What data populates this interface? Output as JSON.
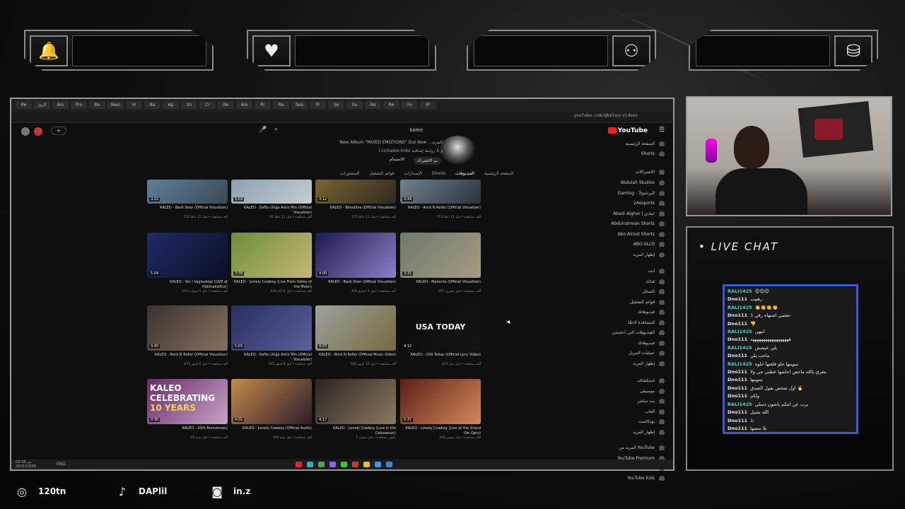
{
  "alerts": [
    {
      "icon": "bell-icon",
      "glyph": "🔔"
    },
    {
      "icon": "heart-hand-icon",
      "glyph": "♥"
    },
    {
      "icon": "users-icon",
      "glyph": "⚇"
    },
    {
      "icon": "coins-icon",
      "glyph": "⛁"
    }
  ],
  "browser": {
    "url": "youtube.com/@kaleo/videos",
    "tabs": [
      "Re",
      "الرئ",
      "Am",
      "Pro",
      "Bo",
      "Nwo",
      "Vi",
      "Ba",
      "Ap",
      "Sn",
      "Cr",
      "Re",
      "Am",
      "Pr",
      "Re",
      "Sea",
      "Pi",
      "Se",
      "Sa",
      "Re",
      "Re",
      "Fo",
      "Pr"
    ]
  },
  "youtube": {
    "logo": "YouTube",
    "search_text": "kaleo",
    "channel_line1": "New Album \"MIXED EMOTIONS\" Out Now ...المزيد",
    "channel_line2": "l.co/kaleo-links و 5 روابط إضافية",
    "subscribe_label": "تم الاشتراك",
    "join_label": "الانضمام",
    "channel_tabs": [
      "الصفحة الرئيسية",
      "الفيديوهات",
      "Shorts",
      "الإصدارات",
      "قوائم التشغيل",
      "المنشورات"
    ],
    "sidebar": [
      "الصفحة الرئيسية",
      "Shorts",
      "الاشتراكات",
      "Sbdulah Studios",
      "Gaming - 3البرنامج",
      "24esports",
      "Abadi Alghar | عبادي",
      "Abdulrahman Shorts",
      "Abo Alroot Shorts",
      "ABO-SLLD",
      "إظهار المزيد",
      "أنت",
      "قناتك",
      "السجل",
      "قوائم التشغيل",
      "فيديوهاتك",
      "المشاهدة لاحقًا",
      "الفيديوهات التي أعجبتني",
      "فيديوهاتك",
      "عمليات التنزيل",
      "إظهار المزيد",
      "استكشاف",
      "موسيقى",
      "بث مباشر",
      "ألعاب",
      "بودكاست",
      "إظهار المزيد",
      "المزيد من YouTube",
      "YouTube Premium",
      "YouTube Music",
      "YouTube Kids"
    ],
    "videos": [
      {
        "title": "KALEO - Back Door (Official Visualizer)",
        "meta": "152 ألف مشاهدة • قبل 11 عامًا",
        "dur": "3:22",
        "c1": "#5e7f99",
        "c2": "#3a4a55"
      },
      {
        "title": "KALEO - Sofðu Unga Ástin Mín (Official Visualizer)",
        "meta": "81 ألف مشاهدة • قبل 11 عامًا",
        "dur": "5:03",
        "c1": "#8aa3b0",
        "c2": "#c5cbd0"
      },
      {
        "title": "KALEO - Bloodline (Official Visualizer)",
        "meta": "275 ألف مشاهدة • قبل 11 عامًا",
        "dur": "3:12",
        "c1": "#7a6430",
        "c2": "#2e2a22"
      },
      {
        "title": "KALEO - Rock N Roller (Official Visualizer)",
        "meta": "113 ألف مشاهدة • قبل 11 عامًا",
        "dur": "3:44",
        "c1": "#6f8290",
        "c2": "#2a333a"
      },
      {
        "title": "KALEO - Vor í Vaglaskógi (LIVE at Hjálmaklettur)",
        "meta": "215 ألف مشاهدة • قبل 5 سنوات",
        "dur": "5:04",
        "c1": "#1f2a66",
        "c2": "#0b0f25"
      },
      {
        "title": "KALEO - Lonely Cowboy (Live From Valley of the Moon)",
        "meta": "232 ألف مشاهدة • قبل 6 أيام",
        "dur": "3:58",
        "c1": "#6c8f3a",
        "c2": "#c6b775"
      },
      {
        "title": "KALEO - Back Door (Official Visualizer)",
        "meta": "459 ألف مشاهدة • قبل 3 أسابيع",
        "dur": "4:00",
        "c1": "#1e1a4a",
        "c2": "#8a80c8"
      },
      {
        "title": "KALEO - Mamcita (Official Visualizer)",
        "meta": "197 ألف مشاهدة • قبل شهرين",
        "dur": "3:31",
        "c1": "#6d7a6e",
        "c2": "#a79a80"
      },
      {
        "title": "KALEO - Rock N Roller (Official Visualizer)",
        "meta": "672 ألف مشاهدة • قبل 6 أشهر",
        "dur": "3:45",
        "c1": "#3a3330",
        "c2": "#857060"
      },
      {
        "title": "KALEO - Sofðu Unga Ástin Mín (Official Visualizer)",
        "meta": "325 ألف مشاهدة • قبل 8 أشهر",
        "dur": "5:03",
        "c1": "#2a2e60",
        "c2": "#5a5f9a"
      },
      {
        "title": "KALEO - Rock N Roller (Official Music Video)",
        "meta": "582 ألف مشاهدة • قبل 10 أشهر",
        "dur": "4:03",
        "c1": "#9ea0a0",
        "c2": "#766a3c"
      },
      {
        "title": "KALEO - USA Today (Official Lyric Video)",
        "meta": "423 ألف مشاهدة • قبل سنة",
        "dur": "4:12",
        "c1": "#0b0b0b",
        "c2": "#141414"
      },
      {
        "title": "KALEO - 10th Anniversary",
        "meta": "25 ألف مشاهدة • قبل سنة",
        "dur": "0:30",
        "c1": "#6b2a6a",
        "c2": "#c6a5c5"
      },
      {
        "title": "KALEO - Lonely Cowboy (Official Audio)",
        "meta": "465 ألف مشاهدة • قبل سنة",
        "dur": "4:55",
        "c1": "#c38a4b",
        "c2": "#2e1d2c"
      },
      {
        "title": "KALEO - Lonely Cowboy (Live in the Colosseum)",
        "meta": "1 مليون مشاهدة • قبل سنتين",
        "dur": "4:17",
        "c1": "#2a2520",
        "c2": "#8a7a60"
      },
      {
        "title": "KALEO - Lonely Cowboy (Live at the Grand Ole Opry)",
        "meta": "295 ألف مشاهدة • قبل سنتين",
        "dur": "5:37",
        "c1": "#5a1f18",
        "c2": "#d58a5a"
      }
    ],
    "usa_today_text": "USA TODAY",
    "anniversary_text": [
      "KALEO",
      "CELEBRATING",
      "10 YEARS"
    ]
  },
  "taskbar": {
    "lang": "ENG",
    "time": "ص 03:58",
    "date": "2025/10/06"
  },
  "chat": {
    "title": "LIVE CHAT",
    "messages": [
      {
        "user": "RALI1425",
        "text": "😊😊😊",
        "color": "#3dd6c9"
      },
      {
        "user": "Dno111",
        "text": "رهييب",
        "color": "#e8e8e8"
      },
      {
        "user": "RALI1425",
        "text": "👏👏👏👏",
        "color": "#3dd6c9"
      },
      {
        "user": "Dno111",
        "text": "نفسي اشتهاه رقي 1-",
        "color": "#e8e8e8"
      },
      {
        "user": "Dno111",
        "text": "👎",
        "color": "#e8e8e8"
      },
      {
        "user": "RALI1425",
        "text": "انتهى",
        "color": "#3dd6c9"
      },
      {
        "user": "Dno111",
        "text": "ههههههههههههههههههه",
        "color": "#e8e8e8"
      },
      {
        "user": "RALI1425",
        "text": "يلي عيشش",
        "color": "#3dd6c9"
      },
      {
        "user": "Dno111",
        "text": "ماحب يلي",
        "color": "#e8e8e8"
      },
      {
        "user": "RALI1425",
        "text": "سوينها حلو قلعتها حلوه",
        "color": "#3dd6c9"
      },
      {
        "user": "Dno111",
        "text": "معري يالله ماحص احاشها عطني جي ولا",
        "color": "#e8e8e8"
      },
      {
        "user": "Dno111",
        "text": "سوينها",
        "color": "#e8e8e8"
      },
      {
        "user": "Dno111",
        "text": "اول شخص يقول الصدق 🔥",
        "color": "#e8e8e8"
      },
      {
        "user": "Dno111",
        "text": "ولكم",
        "color": "#e8e8e8"
      },
      {
        "user": "RALI1425",
        "text": "يرب عن انتكم ياشون دسلي",
        "color": "#3dd6c9"
      },
      {
        "user": "Dno111",
        "text": "الله يشيل",
        "color": "#e8e8e8"
      },
      {
        "user": "Dno111",
        "text": "1-",
        "color": "#e8e8e8"
      },
      {
        "user": "Dno111",
        "text": "بلا سعتها",
        "color": "#e8e8e8"
      }
    ]
  },
  "socials": [
    {
      "icon": "instagram-icon",
      "glyph": "◎",
      "label": "120tn"
    },
    {
      "icon": "tiktok-icon",
      "glyph": "♪",
      "label": "DAPlil"
    },
    {
      "icon": "discord-icon",
      "glyph": "◙",
      "label": "in.z"
    }
  ]
}
